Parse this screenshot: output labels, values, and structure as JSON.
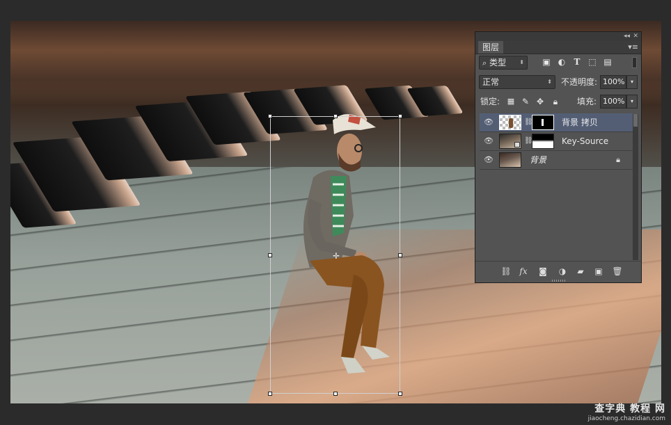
{
  "layers_panel": {
    "tab_label": "图层",
    "filter": {
      "label": "类型",
      "icons": [
        "image-filter-icon",
        "adjustment-filter-icon",
        "type-filter-icon",
        "shape-filter-icon",
        "smartobject-filter-icon"
      ]
    },
    "blend_mode": "正常",
    "opacity_label": "不透明度:",
    "opacity_value": "100%",
    "lock_label": "锁定:",
    "fill_label": "填充:",
    "fill_value": "100%",
    "layers": [
      {
        "name": "背景 拷贝",
        "visible": true,
        "selected": true
      },
      {
        "name": "Key-Source",
        "visible": true,
        "selected": false
      },
      {
        "name": "背景",
        "visible": true,
        "selected": false,
        "locked": true
      }
    ],
    "bottom_icons": [
      "link-layers-icon",
      "fx-icon",
      "mask-icon",
      "adjustment-icon",
      "group-folder-icon",
      "new-layer-icon",
      "trash-icon"
    ],
    "fx_label": "fx"
  },
  "watermark": {
    "line1": "查字典 教程 网",
    "line2": "jiaocheng.chazidian.com"
  }
}
